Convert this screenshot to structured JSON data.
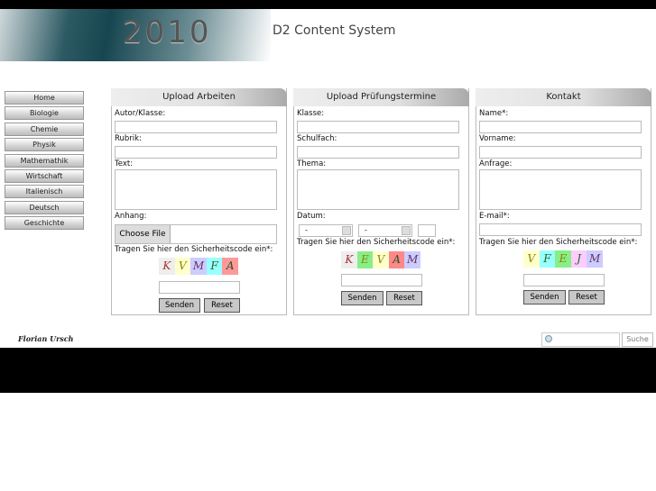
{
  "header": {
    "year": "2010",
    "brand": "D2 Content System"
  },
  "nav": [
    "Home",
    "Biologie",
    "Chemie",
    "Physik",
    "Mathemathik",
    "Wirtschaft",
    "Italienisch",
    "Deutsch",
    "Geschichte"
  ],
  "upload": {
    "title": "Upload Arbeiten",
    "author": "Autor/Klasse:",
    "rubrik": "Rubrik:",
    "text": "Text:",
    "anhang": "Anhang:",
    "file_btn": "Choose File",
    "code": "Tragen Sie hier den Sicherheitscode ein*:",
    "captcha": [
      "K",
      "V",
      "M",
      "F",
      "A"
    ],
    "send": "Senden",
    "reset": "Reset"
  },
  "exam": {
    "title": "Upload Prüfungstermine",
    "klasse": "Klasse:",
    "fach": "Schulfach:",
    "thema": "Thema:",
    "datum": "Datum:",
    "sel1": "-",
    "sel2": "-",
    "code": "Tragen Sie hier den Sicherheitscode ein*:",
    "captcha": [
      "K",
      "E",
      "V",
      "A",
      "M"
    ],
    "send": "Senden",
    "reset": "Reset"
  },
  "contact": {
    "title": "Kontakt",
    "name": "Name*:",
    "vorname": "Vorname:",
    "anfrage": "Anfrage:",
    "email": "E-mail*:",
    "code": "Tragen Sie hier den Sicherheitscode ein*:",
    "captcha": [
      "V",
      "F",
      "E",
      "J",
      "M"
    ],
    "send": "Senden",
    "reset": "Reset"
  },
  "footer": {
    "signature": "Florian Ursch",
    "search_btn": "Suche"
  }
}
